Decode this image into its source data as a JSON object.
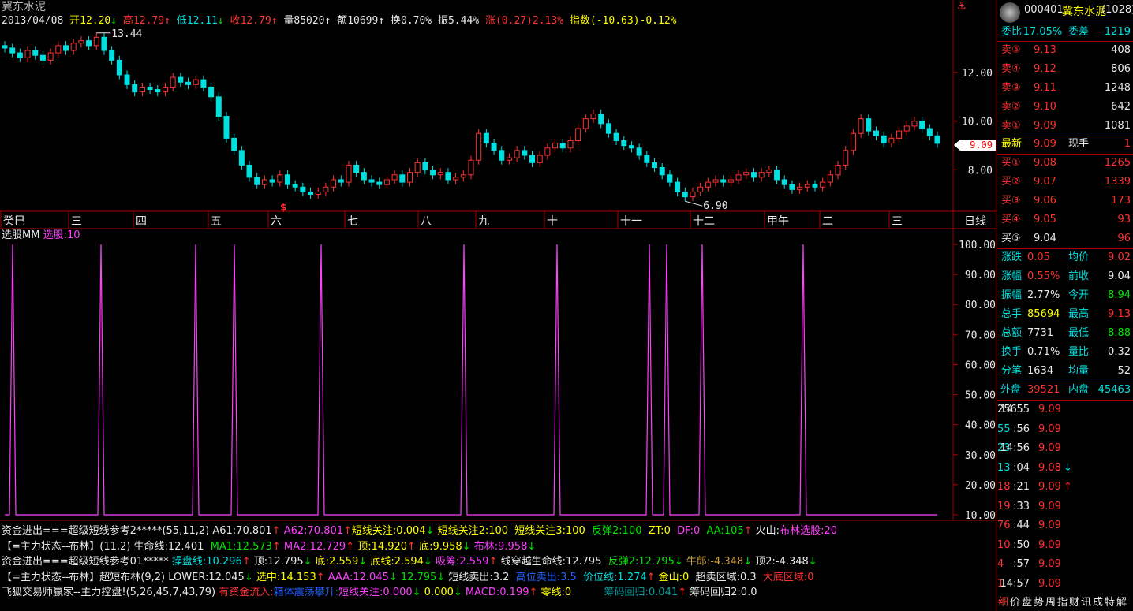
{
  "chart_title": "冀东水泥",
  "info_bar": {
    "date": "2013/04/08",
    "open_label": "开",
    "open": "12.20",
    "high_label": "高",
    "high": "12.79",
    "low_label": "低",
    "low": "12.11",
    "close_label": "收",
    "close": "12.79",
    "vol_label": "量",
    "vol": "85020",
    "amt_label": "额",
    "amt": "10699",
    "turn_label": "换",
    "turn": "0.70%",
    "amp_label": "振",
    "amp": "5.44%",
    "chg_label": "涨",
    "chg": "(0.27)2.13%",
    "idx_label": "指数",
    "idx": "(-10.63)-0.12%"
  },
  "price_axis": [
    "12.00",
    "10.00",
    "8.00"
  ],
  "current_price_tag": "9.09",
  "high_annotation": "13.44",
  "low_annotation": "6.90",
  "month_labels": [
    "癸巳",
    "三",
    "四",
    "五",
    "六",
    "七",
    "八",
    "九",
    "十",
    "十一",
    "十二",
    "甲午",
    "二",
    "三"
  ],
  "period_label": "日线",
  "dividend_marker": "$",
  "indicator_title": "选股MM",
  "indicator_value": "选股:10",
  "indicator_axis": [
    "100.00",
    "90.00",
    "80.00",
    "70.00",
    "60.00",
    "50.00",
    "40.00",
    "30.00",
    "20.00",
    "10.00"
  ],
  "indicator_lines": [
    [
      {
        "t": "资金进出===超级短线参考2*****(55,11,2) ",
        "c": "#e8e8e8"
      },
      {
        "t": "A61:70.801",
        "c": "#e8e8e8"
      },
      {
        "t": "↑ ",
        "c": "#ff3232"
      },
      {
        "t": "A62:70.801",
        "c": "#ff40ff"
      },
      {
        "t": "↑",
        "c": "#ff3232"
      },
      {
        "t": "短线关注:0.004",
        "c": "#ffff00"
      },
      {
        "t": "↓ ",
        "c": "#00e600"
      },
      {
        "t": "短线关注2:100  ",
        "c": "#ffff00"
      },
      {
        "t": "短线关注3:100  ",
        "c": "#ffff00"
      },
      {
        "t": "反弹2:100  ",
        "c": "#00e600"
      },
      {
        "t": "ZT:0  ",
        "c": "#ffff00"
      },
      {
        "t": "DF:0  ",
        "c": "#ff40ff"
      },
      {
        "t": "AA:105",
        "c": "#00e600"
      },
      {
        "t": "↑ ",
        "c": "#ff3232"
      },
      {
        "t": "火山:",
        "c": "#e8e8e8"
      },
      {
        "t": "布林选股:20",
        "c": "#ff40ff"
      }
    ],
    [
      {
        "t": "【=主力状态--布林】(11,2) ",
        "c": "#e8e8e8"
      },
      {
        "t": "生命线:12.401  ",
        "c": "#e8e8e8"
      },
      {
        "t": "MA1:12.573",
        "c": "#00e600"
      },
      {
        "t": "↑ ",
        "c": "#ff3232"
      },
      {
        "t": "MA2:12.729",
        "c": "#ff40ff"
      },
      {
        "t": "↑ ",
        "c": "#ff3232"
      },
      {
        "t": "顶:14.920",
        "c": "#ffff00"
      },
      {
        "t": "↑ ",
        "c": "#ff3232"
      },
      {
        "t": "底:9.958",
        "c": "#ffff00"
      },
      {
        "t": "↓ ",
        "c": "#00e600"
      },
      {
        "t": "布林:9.958",
        "c": "#ff40ff"
      },
      {
        "t": "↓",
        "c": "#00e600"
      }
    ],
    [
      {
        "t": "资金进出===超级短线参考01***** ",
        "c": "#e8e8e8"
      },
      {
        "t": "操盘线:10.296",
        "c": "#00e0e0"
      },
      {
        "t": "↑ ",
        "c": "#ff3232"
      },
      {
        "t": "顶:12.795",
        "c": "#e8e8e8"
      },
      {
        "t": "↓ ",
        "c": "#00e600"
      },
      {
        "t": "底:2.559",
        "c": "#ffff00"
      },
      {
        "t": "↓ ",
        "c": "#00e600"
      },
      {
        "t": "底线:2.594",
        "c": "#ffff00"
      },
      {
        "t": "↓ ",
        "c": "#00e600"
      },
      {
        "t": "吸筹:2.559",
        "c": "#ff40ff"
      },
      {
        "t": "↑ ",
        "c": "#ff3232"
      },
      {
        "t": "线穿越生命线:12.795  ",
        "c": "#e8e8e8"
      },
      {
        "t": "反弹2:12.795",
        "c": "#00e600"
      },
      {
        "t": "↓ ",
        "c": "#00e600"
      },
      {
        "t": "牛郎:-4.348",
        "c": "#c8a040"
      },
      {
        "t": "↓ ",
        "c": "#00e600"
      },
      {
        "t": "顶2:-4.348",
        "c": "#e8e8e8"
      },
      {
        "t": "↓",
        "c": "#00e600"
      }
    ],
    [
      {
        "t": "【=主力状态--布林】超短布林(9,2) ",
        "c": "#e8e8e8"
      },
      {
        "t": "LOWER:12.045",
        "c": "#e8e8e8"
      },
      {
        "t": "↓ ",
        "c": "#00e600"
      },
      {
        "t": "选中:14.153",
        "c": "#ffff00"
      },
      {
        "t": "↑ ",
        "c": "#ff3232"
      },
      {
        "t": "AAA:12.045",
        "c": "#ff40ff"
      },
      {
        "t": "↓ ",
        "c": "#00e600"
      },
      {
        "t": "12.795",
        "c": "#00e600"
      },
      {
        "t": "↓ ",
        "c": "#00e600"
      },
      {
        "t": "短线卖出:3.2  ",
        "c": "#e8e8e8"
      },
      {
        "t": "高位卖出:3.5  ",
        "c": "#2060ff"
      },
      {
        "t": "价位线:1.274",
        "c": "#00e0e0"
      },
      {
        "t": "↑ ",
        "c": "#ff3232"
      },
      {
        "t": "金山:0  ",
        "c": "#ffff00"
      },
      {
        "t": "超卖区域:0.3  ",
        "c": "#e8e8e8"
      },
      {
        "t": "大底区域:0",
        "c": "#ff3232"
      }
    ],
    [
      {
        "t": "飞狐交易师赢家--主力控盘!(5,26,45,7,43,79) ",
        "c": "#e8e8e8"
      },
      {
        "t": "有资金流入:",
        "c": "#ff3232"
      },
      {
        "t": "箱体震荡攀升:",
        "c": "#2060ff"
      },
      {
        "t": "短线关注:0.000",
        "c": "#ff40ff"
      },
      {
        "t": "↓ ",
        "c": "#00e600"
      },
      {
        "t": "0.000",
        "c": "#ffff00"
      },
      {
        "t": "↓ ",
        "c": "#00e600"
      },
      {
        "t": "MACD:0.199",
        "c": "#ff40ff"
      },
      {
        "t": "↑ ",
        "c": "#ff3232"
      },
      {
        "t": "零线:0          ",
        "c": "#ffff00"
      },
      {
        "t": "筹码回归:0.041",
        "c": "#00a0a0"
      },
      {
        "t": "↑ ",
        "c": "#ff3232"
      },
      {
        "t": "筹码回归2:0.0",
        "c": "#e8e8e8"
      }
    ]
  ],
  "panel": {
    "code": "000401",
    "name": "冀东水泥",
    "extra": "(1028)",
    "weibi_label": "委比",
    "weibi": "-17.05%",
    "weicha_label": "委差",
    "weicha": "-1219",
    "asks": [
      {
        "label": "卖⑤",
        "price": "9.13",
        "vol": "408"
      },
      {
        "label": "卖④",
        "price": "9.12",
        "vol": "806"
      },
      {
        "label": "卖③",
        "price": "9.11",
        "vol": "1248"
      },
      {
        "label": "卖②",
        "price": "9.10",
        "vol": "642"
      },
      {
        "label": "卖①",
        "price": "9.09",
        "vol": "1081"
      }
    ],
    "last_label": "最新",
    "last": "9.09",
    "xianshou_label": "现手",
    "xianshou": "1",
    "bids": [
      {
        "label": "买①",
        "price": "9.08",
        "vol": "1265"
      },
      {
        "label": "买②",
        "price": "9.07",
        "vol": "1339"
      },
      {
        "label": "买③",
        "price": "9.06",
        "vol": "173"
      },
      {
        "label": "买④",
        "price": "9.05",
        "vol": "93"
      },
      {
        "label": "买⑤",
        "price": "9.04",
        "vol": "96"
      }
    ],
    "stats": [
      {
        "l1": "涨跌",
        "v1": "0.05",
        "c1": "#ff3232",
        "l2": "均价",
        "v2": "9.02",
        "c2": "#ff3232"
      },
      {
        "l1": "涨幅",
        "v1": "0.55%",
        "c1": "#ff3232",
        "l2": "前收",
        "v2": "9.04",
        "c2": "#e8e8e8"
      },
      {
        "l1": "振幅",
        "v1": "2.77%",
        "c1": "#e8e8e8",
        "l2": "今开",
        "v2": "8.94",
        "c2": "#00e600"
      },
      {
        "l1": "总手",
        "v1": "85694",
        "c1": "#ffff00",
        "l2": "最高",
        "v2": "9.13",
        "c2": "#ff3232"
      },
      {
        "l1": "总额",
        "v1": "7731",
        "c1": "#e8e8e8",
        "l2": "最低",
        "v2": "8.88",
        "c2": "#00e600"
      },
      {
        "l1": "换手",
        "v1": "0.71%",
        "c1": "#e8e8e8",
        "l2": "量比",
        "v2": "0.32",
        "c2": "#e8e8e8"
      },
      {
        "l1": "分笔",
        "v1": "1634",
        "c1": "#e8e8e8",
        "l2": "均量",
        "v2": "52",
        "c2": "#e8e8e8"
      }
    ],
    "waipan_label": "外盘",
    "waipan": "39521",
    "neipan_label": "内盘",
    "neipan": "45463",
    "ticks": [
      {
        "time": "14:55",
        "price": "9.09",
        "arrow": "",
        "vol": "256",
        "vc": "#e8e8e8"
      },
      {
        "time": ":56",
        "price": "9.09",
        "arrow": "",
        "vol": "55",
        "vc": "#00e0e0"
      },
      {
        "time": "14:56",
        "price": "9.09",
        "arrow": "",
        "vol": "23",
        "vc": "#00e0e0"
      },
      {
        "time": ":04",
        "price": "9.08",
        "arrow": "↓",
        "vol": "13",
        "vc": "#00e0e0"
      },
      {
        "time": ":21",
        "price": "9.09",
        "arrow": "↑",
        "vol": "18",
        "vc": "#ff3232"
      },
      {
        "time": ":33",
        "price": "9.09",
        "arrow": "",
        "vol": "19",
        "vc": "#ff3232"
      },
      {
        "time": ":44",
        "price": "9.09",
        "arrow": "",
        "vol": "76",
        "vc": "#ff3232"
      },
      {
        "time": ":50",
        "price": "9.09",
        "arrow": "",
        "vol": "10",
        "vc": "#ff3232"
      },
      {
        "time": ":57",
        "price": "9.09",
        "arrow": "",
        "vol": "4",
        "vc": "#ff3232"
      },
      {
        "time": "14:57",
        "price": "9.09",
        "arrow": "",
        "vol": "1",
        "vc": "#ff3232"
      }
    ],
    "bottom_tabs": [
      "细",
      "价",
      "盘",
      "势",
      "周",
      "指",
      "财",
      "讯",
      "成",
      "特",
      "解"
    ],
    "colors": {
      "up": "#ff3232",
      "down": "#00e0e0",
      "frame": "#aa0000"
    }
  },
  "chart_data": {
    "type": "candlestick",
    "price_range": [
      6.5,
      14.0
    ],
    "price_ticks": [
      8,
      10,
      12
    ],
    "annotations": {
      "high": 13.44,
      "low": 6.9,
      "last": 9.09
    },
    "closes": [
      13.0,
      12.8,
      12.6,
      12.9,
      12.7,
      12.5,
      12.8,
      13.1,
      12.9,
      13.2,
      13.3,
      13.1,
      13.44,
      12.9,
      12.5,
      11.9,
      11.5,
      11.2,
      11.4,
      11.3,
      11.2,
      11.4,
      11.8,
      11.6,
      11.5,
      11.7,
      11.4,
      11.0,
      10.2,
      9.3,
      8.8,
      8.2,
      7.7,
      7.4,
      7.6,
      7.5,
      7.8,
      7.4,
      7.3,
      7.1,
      7.0,
      7.1,
      7.3,
      7.6,
      7.5,
      8.2,
      7.9,
      7.6,
      7.5,
      7.4,
      7.6,
      7.8,
      7.5,
      7.9,
      8.3,
      8.0,
      7.8,
      7.9,
      7.6,
      7.7,
      7.8,
      8.4,
      9.5,
      9.1,
      8.8,
      8.4,
      8.5,
      8.8,
      8.6,
      8.3,
      8.6,
      8.9,
      9.1,
      8.9,
      9.2,
      9.7,
      10.1,
      10.3,
      9.9,
      9.5,
      9.2,
      9.0,
      8.9,
      8.6,
      8.3,
      8.1,
      7.8,
      7.5,
      7.1,
      6.9,
      7.1,
      7.3,
      7.5,
      7.6,
      7.5,
      7.6,
      7.8,
      7.9,
      7.7,
      7.9,
      8.0,
      7.6,
      7.4,
      7.2,
      7.3,
      7.4,
      7.3,
      7.5,
      7.8,
      8.2,
      8.8,
      9.5,
      10.1,
      9.6,
      9.4,
      9.1,
      9.3,
      9.6,
      9.8,
      10.0,
      9.7,
      9.4,
      9.09
    ],
    "indicator_range": [
      10,
      100
    ],
    "indicator_spikes": [
      16,
      128,
      248,
      297,
      407,
      588,
      706,
      823,
      845,
      890,
      1018
    ],
    "indicator_value": 10
  }
}
